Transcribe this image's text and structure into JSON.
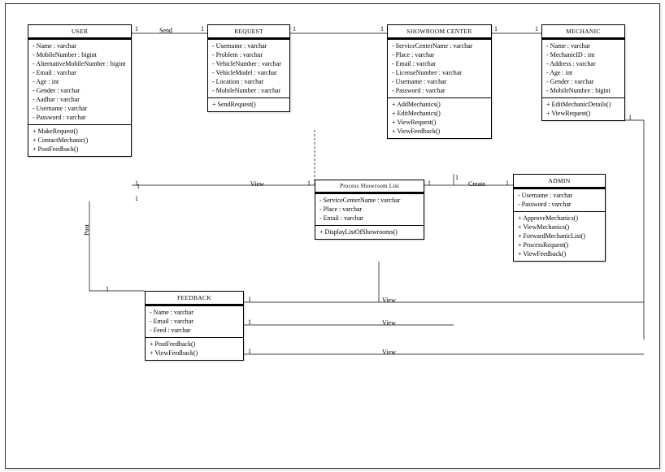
{
  "classes": {
    "user": {
      "title": "USER",
      "attrs": [
        "- Name : varchar",
        "- MobileNumber : bigint",
        "- AlternativeMobileNumber : bigint",
        "- Email : varchar",
        "- Age : int",
        "- Gender : varchar",
        "- Aadhar : varchar",
        "- Username : varchar",
        "- Password : varchar"
      ],
      "ops": [
        "+ MakeRequest()",
        "+ ContactMechanic()",
        "+ PostFeedback()"
      ]
    },
    "request": {
      "title": "REQUEST",
      "attrs": [
        "- Username : varchar",
        "- Problem : varchar",
        "- VehicleNumber : varchar",
        "- VehicleModel : varchar",
        "- Location : varchar",
        "- MobileNumber : varchar"
      ],
      "ops": [
        "+ SendRequest()"
      ]
    },
    "showroom": {
      "title": "SHOWROOM CENTER",
      "attrs": [
        "- ServiceCenterName : varchar",
        "- Place : varchar",
        "- Email : varchar",
        "- LicenseNumber : varchar",
        "- Username : varchar",
        "- Password : varchar"
      ],
      "ops": [
        "+ AddMechanics()",
        "+ EditMechanics()",
        "+ ViewRequest()",
        "+ ViewFeedback()"
      ]
    },
    "mechanic": {
      "title": "MECHANIC",
      "attrs": [
        "- Name : varchar",
        "- MechanicID : int",
        "- Address : varchar",
        "- Age : int",
        "- Gender : varchar",
        "- MobileNumbre : bigint"
      ],
      "ops": [
        "+ EditMechanicDetails()",
        "+ ViewRequest()"
      ]
    },
    "processList": {
      "title": "Process Showroom List",
      "attrs": [
        "- ServiceCenterName : varchar",
        "- Place : varchar",
        "- Email : varchar"
      ],
      "ops": [
        "+ DisplayListOfShowrooms()"
      ]
    },
    "admin": {
      "title": "ADMIN",
      "attrs": [
        "- Username : varchar",
        "- Password : varchar"
      ],
      "ops": [
        "+ ApproveMechanics()",
        "+ ViewMechanics()",
        "+ ForwardMechanicList()",
        "+ ProcessRequest()",
        "+ ViewFeedback()"
      ]
    },
    "feedback": {
      "title": "FEEDBACK",
      "attrs": [
        "- Name : varchar",
        "- Email : varchar",
        "- Feed : varchar"
      ],
      "ops": [
        "+ PostFeedback()",
        "+ ViewFeedback()"
      ]
    }
  },
  "labels": {
    "send": "Send",
    "view1": "View",
    "create": "Create",
    "post": "Post",
    "view2": "View",
    "view3": "View",
    "view4": "View"
  },
  "mults": {
    "m1": "1",
    "m2": "1",
    "m3": "1",
    "m4": "1",
    "m5": "1",
    "m6": "1",
    "m7": "1",
    "m8": "1",
    "m9": "1",
    "m10": "1",
    "m11": "1",
    "m12": "1",
    "m13": "1",
    "m14": "1",
    "m15": "1",
    "m16": "1",
    "m17": "1",
    "m18": "1"
  }
}
